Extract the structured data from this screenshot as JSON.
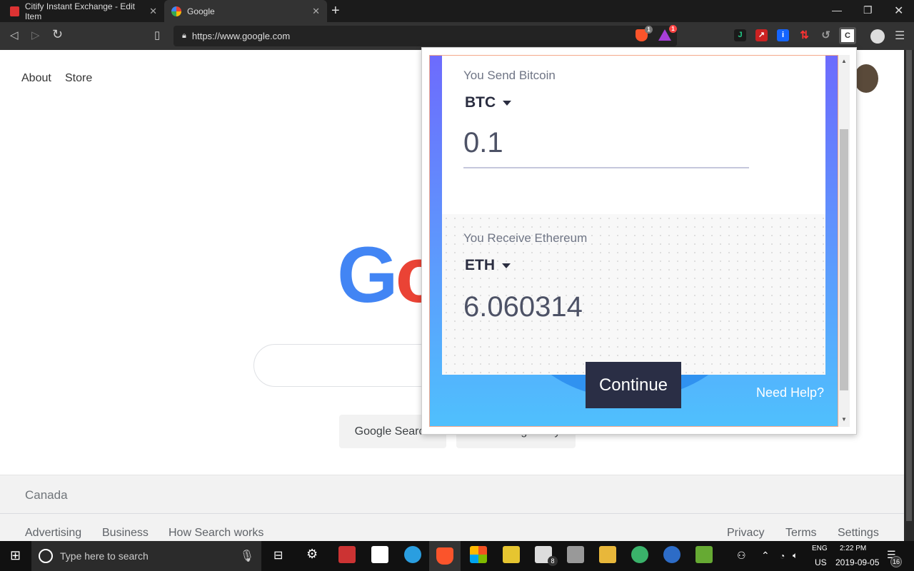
{
  "browser": {
    "tabs": [
      {
        "title": "Citify Instant Exchange - Edit Item",
        "active": false
      },
      {
        "title": "Google",
        "active": true
      }
    ],
    "url": "https://www.google.com",
    "extension_badges": {
      "brave_shields": "1",
      "rewards": "1"
    },
    "icons": [
      "back-icon",
      "forward-icon",
      "reload-icon",
      "bookmark-icon",
      "lock-icon",
      "brave-shield-icon",
      "brave-rewards-icon",
      "menu-icon"
    ]
  },
  "google": {
    "top_links": [
      "About",
      "Store"
    ],
    "buttons": [
      "Google Search",
      "I'm Feeling Lucky"
    ],
    "footer": {
      "country": "Canada",
      "left": [
        "Advertising",
        "Business",
        "How Search works"
      ],
      "right": [
        "Privacy",
        "Terms",
        "Settings"
      ]
    }
  },
  "popup": {
    "send": {
      "label": "You Send Bitcoin",
      "coin": "BTC",
      "amount": "0.1"
    },
    "receive": {
      "label": "You Receive Ethereum",
      "coin": "ETH",
      "amount": "6.060314"
    },
    "continue_label": "Continue",
    "help_label": "Need Help?",
    "colors": {
      "gradient_top": "#6d6bfd",
      "gradient_bottom": "#4fc0fd",
      "button": "#2a2e45"
    }
  },
  "taskbar": {
    "search_placeholder": "Type here to search",
    "mail_badge": "8",
    "lang_top": "ENG",
    "lang_bottom": "US",
    "time": "2:22 PM",
    "date": "2019-09-05",
    "notifications": "16"
  }
}
